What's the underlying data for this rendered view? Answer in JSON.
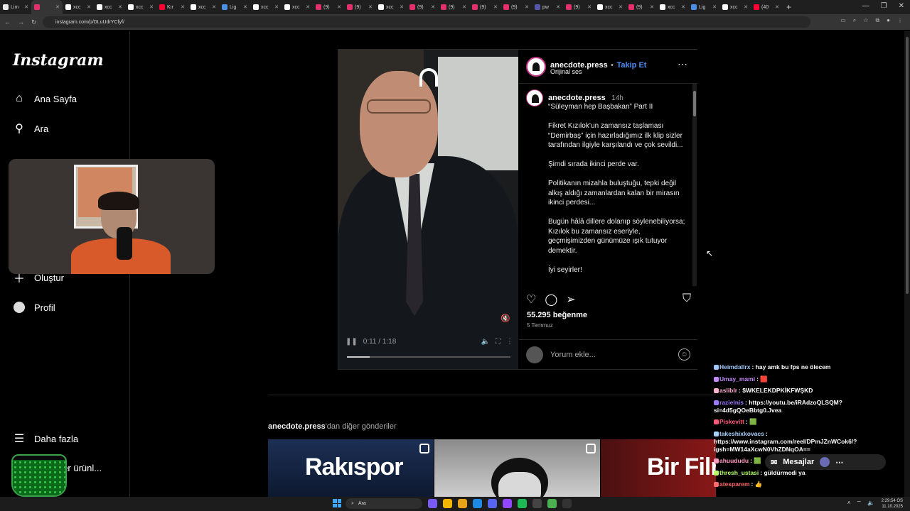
{
  "browser": {
    "tabs": [
      {
        "label": "Lim",
        "color": "#e8e8e8"
      },
      {
        "label": "",
        "color": "#e1306c",
        "active": true
      },
      {
        "label": "xcc",
        "color": "#ffffff"
      },
      {
        "label": "xcc",
        "color": "#ffffff"
      },
      {
        "label": "xcc",
        "color": "#ffffff"
      },
      {
        "label": "Kır",
        "color": "#ff0033"
      },
      {
        "label": "xcc",
        "color": "#ffffff"
      },
      {
        "label": "Lig",
        "color": "#4a90e2"
      },
      {
        "label": "xcc",
        "color": "#ffffff"
      },
      {
        "label": "xcc",
        "color": "#ffffff"
      },
      {
        "label": "(9)",
        "color": "#e1306c"
      },
      {
        "label": "(9)",
        "color": "#e1306c"
      },
      {
        "label": "xcc",
        "color": "#ffffff"
      },
      {
        "label": "(9)",
        "color": "#e1306c"
      },
      {
        "label": "(9)",
        "color": "#e1306c"
      },
      {
        "label": "(9)",
        "color": "#e1306c"
      },
      {
        "label": "(9)",
        "color": "#e1306c"
      },
      {
        "label": "pw",
        "color": "#5555aa"
      },
      {
        "label": "(9)",
        "color": "#e1306c"
      },
      {
        "label": "xcc",
        "color": "#ffffff"
      },
      {
        "label": "(9)",
        "color": "#e1306c"
      },
      {
        "label": "xcc",
        "color": "#ffffff"
      },
      {
        "label": "Lig",
        "color": "#4a90e2"
      },
      {
        "label": "xcc",
        "color": "#ffffff"
      },
      {
        "label": "(40",
        "color": "#ff0033"
      }
    ],
    "url": "instagram.com/p/DLuUdrYCfyf/"
  },
  "sidebar": {
    "logo": "Instagram",
    "items": [
      {
        "label": "Ana Sayfa",
        "icon": "home-icon"
      },
      {
        "label": "Ara",
        "icon": "search-icon"
      },
      {
        "label": "Oluştur",
        "icon": "plus-icon"
      },
      {
        "label": "Profil",
        "icon": "profile-icon"
      },
      {
        "label": "Daha fazla",
        "icon": "menu-icon"
      },
      {
        "label": "n diğer ürünl...",
        "icon": "meta-icon"
      }
    ]
  },
  "post": {
    "username": "anecdote.press",
    "follow": "Takip Et",
    "audio": "Orijinal ses",
    "caption_user": "anecdote.press",
    "caption_time": "14h",
    "caption": "“Süleyman hep Başbakan” Part II\n\nFikret Kızılok’un zamansız taşlaması “Demirbaş” için hazırladığımız ilk klip sizler tarafından ilgiyle karşılandı ve çok sevildi...\n\nŞimdi sırada ikinci perde var.\n\nPolitikanın mizahla buluştuğu, tepki değil alkış aldığı zamanlardan kalan bir mirasın ikinci perdesi...\n\nBugün hâlâ dillere dolanıp söylenebiliyorsa; Kızılok bu zamansız eseriyle, geçmişimizden günümüze ışık tutuyor demektir.\n\nİyi seyirler!",
    "likes": "55.295 beğenme",
    "date": "5 Temmuz",
    "comment_placeholder": "Yorum ekle...",
    "video_time": "0:11 / 1:18",
    "video_progress": 0.14
  },
  "more": {
    "user": "anecdote.press",
    "suffix": "'dan diğer gönderiler",
    "thumbs": [
      "Rakıspor",
      "",
      "Bir Film"
    ]
  },
  "chat": [
    {
      "user": "Heimdallrx",
      "color": "#a0c8ff",
      "text": ": hay amk bu fps ne ölecem"
    },
    {
      "user": "Umay_mami",
      "color": "#c58aff",
      "text": ": 🟥"
    },
    {
      "user": "aslibIr",
      "color": "#ffb0d0",
      "text": ": $WKELEKDPKİKFWŞKD"
    },
    {
      "user": "razielnis",
      "color": "#9d7bff",
      "text": ": https://youtu.be/iRAdzoQLSQM?si=4d5gQOeBbtg0.Jvea"
    },
    {
      "user": "Piskevitt",
      "color": "#ff5a7a",
      "text": ": 🟩"
    },
    {
      "user": "takeshixkovacs",
      "color": "#a6d2ff",
      "text": ": https://www.instagram.com/reel/DPmJZnWCok6/?igsh=MW14aXcwN0VhZDNqOA=="
    },
    {
      "user": "ahuududu",
      "color": "#ff9ac0",
      "text": ": 🟩"
    },
    {
      "user": "thresh_ustasi",
      "color": "#b7ff6a",
      "text": ": güldürmedi ya"
    },
    {
      "user": "atesparem",
      "color": "#ff6a6a",
      "text": ": 👍"
    }
  ],
  "messages_label": "Mesajlar",
  "taskbar": {
    "search": "Ara",
    "time": "2:29:54 ÖS",
    "date": "11.10.2025"
  }
}
